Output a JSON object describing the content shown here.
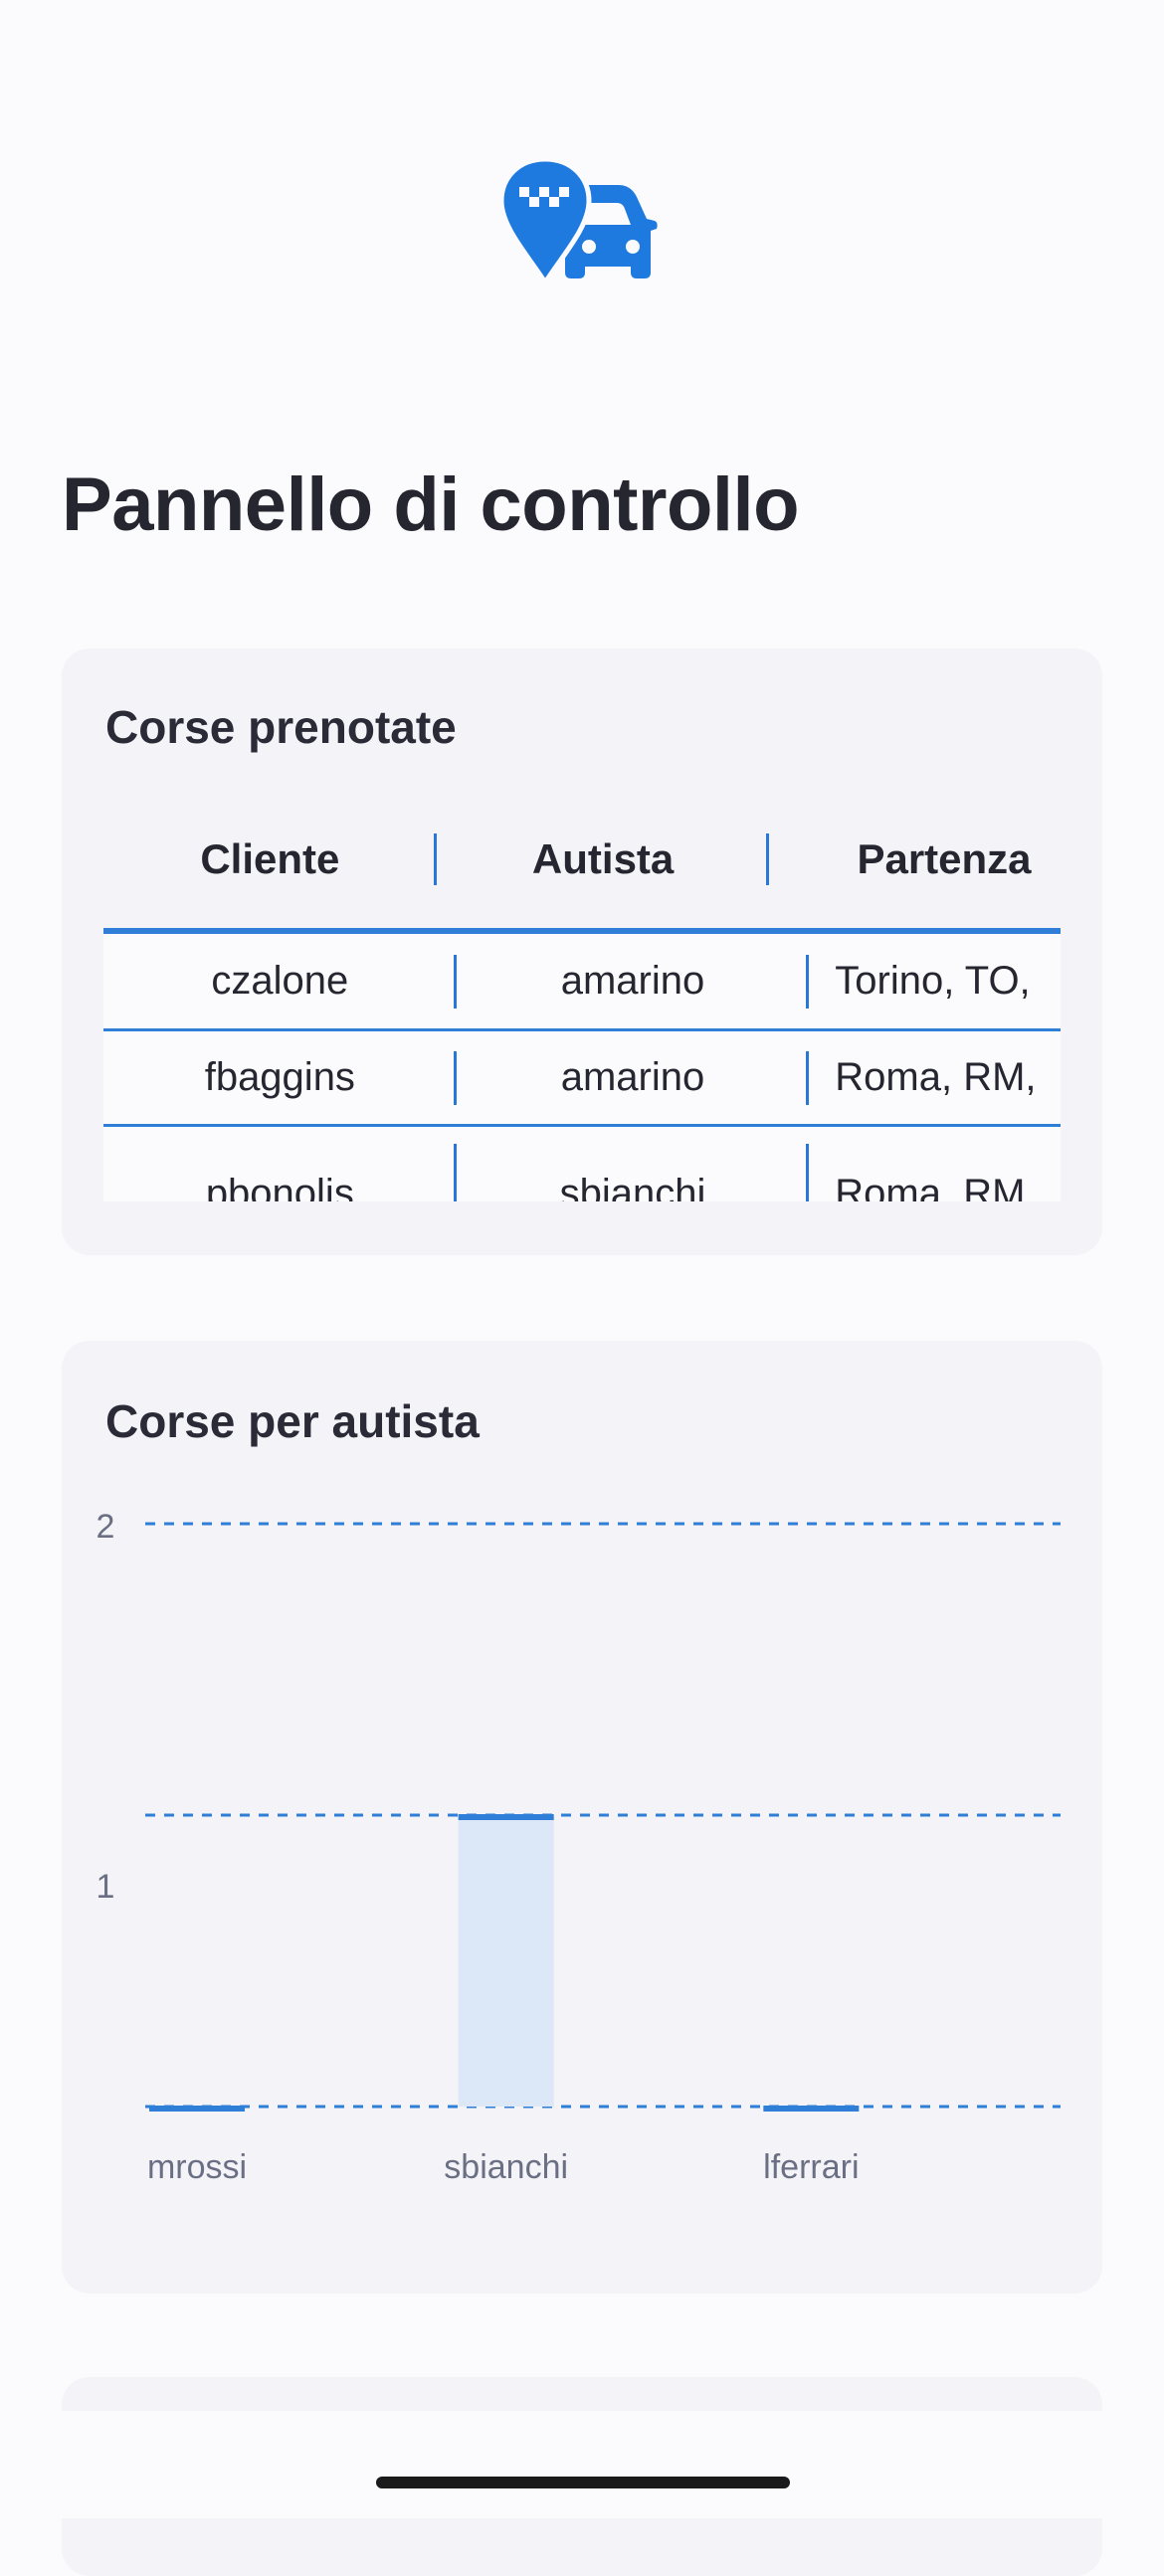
{
  "app": {
    "logo_icon": "taxi-pin-car-icon",
    "accent_color": "#1f7ae0"
  },
  "page": {
    "title": "Pannello di controllo"
  },
  "bookings": {
    "title": "Corse prenotate",
    "columns": [
      "Cliente",
      "Autista",
      "Partenza"
    ],
    "rows": [
      {
        "cliente": "czalone",
        "autista": "amarino",
        "partenza": "Torino, TO,"
      },
      {
        "cliente": "fbaggins",
        "autista": "amarino",
        "partenza": "Roma, RM,"
      },
      {
        "cliente": "pbonolis",
        "autista": "sbianchi",
        "partenza": "Roma, RM,"
      }
    ]
  },
  "rides_chart": {
    "title": "Corse per autista"
  },
  "chart_data": {
    "type": "bar",
    "title": "Corse per autista",
    "categories": [
      "mrossi",
      "sbianchi",
      "lferrari"
    ],
    "values": [
      0,
      1,
      0
    ],
    "ylim": [
      0,
      2
    ],
    "y_ticks": [
      1,
      2
    ],
    "grid": true,
    "bar_color": "#2f7fd9",
    "bar_fill": "#dce7f7"
  }
}
